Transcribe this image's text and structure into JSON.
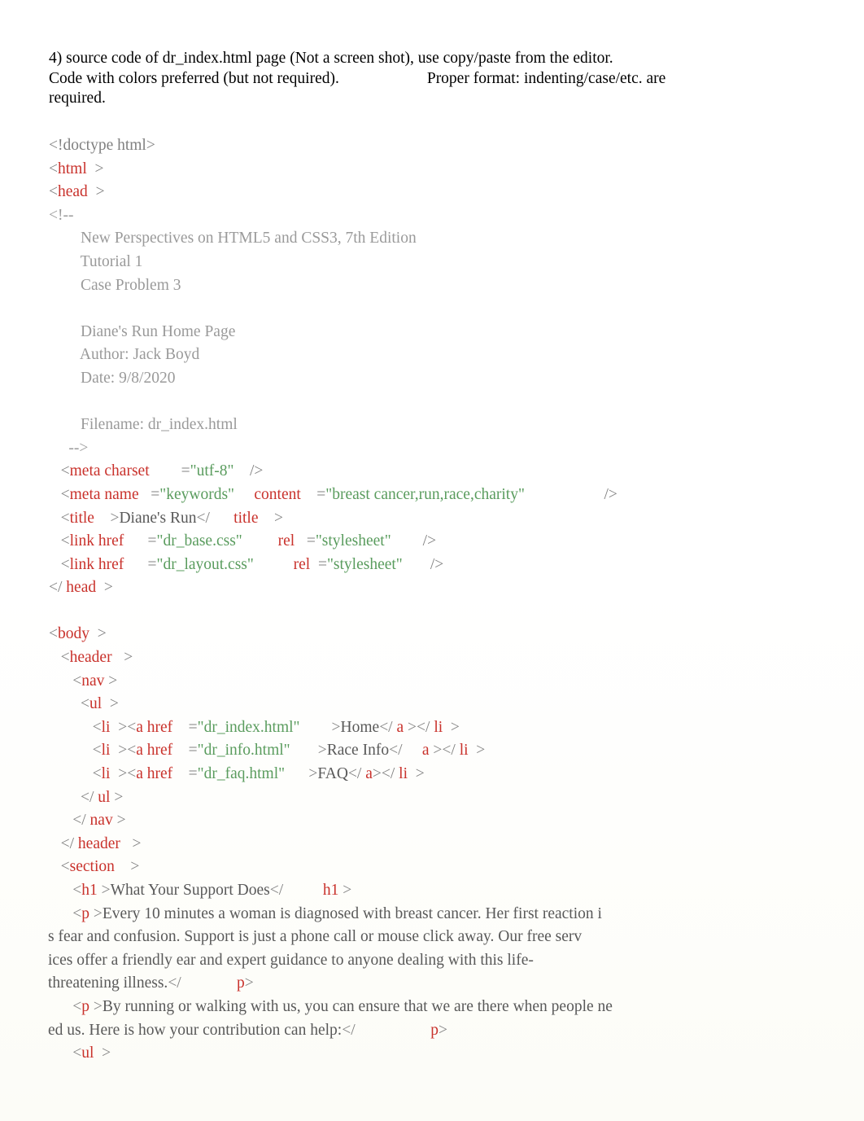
{
  "document": {
    "prompt": {
      "line1": "4) source code of dr_index.html page (Not a screen shot), use copy/paste from the editor.",
      "line2a": "Code with colors preferred (but not required).",
      "line2b": "Proper format: indenting/case/etc. are",
      "line3": "required."
    },
    "code_lines": [
      {
        "id": "l01",
        "text": "<!doctype html>"
      },
      {
        "id": "l02",
        "text": "<html  >"
      },
      {
        "id": "l03",
        "text": "<head  >"
      },
      {
        "id": "l04",
        "text": "<!--"
      },
      {
        "id": "l05",
        "text": "        New Perspectives on HTML5 and CSS3, 7th Edition"
      },
      {
        "id": "l06",
        "text": "        Tutorial 1"
      },
      {
        "id": "l07",
        "text": "        Case Problem 3"
      },
      {
        "id": "l08",
        "text": ""
      },
      {
        "id": "l09",
        "text": "        Diane's Run Home Page"
      },
      {
        "id": "l10",
        "text": "        Author: Jack Boyd"
      },
      {
        "id": "l11",
        "text": "        Date: 9/8/2020"
      },
      {
        "id": "l12",
        "text": ""
      },
      {
        "id": "l13",
        "text": "        Filename: dr_index.html"
      },
      {
        "id": "l14",
        "text": "     -->"
      },
      {
        "id": "l15",
        "text": "   <meta charset        =\"utf-8\"    />"
      },
      {
        "id": "l16",
        "text": "   <meta name   =\"keywords\"     content    =\"breast cancer,run,race,charity\"                    />"
      },
      {
        "id": "l17",
        "text": "   <title    >Diane's Run</      title    >"
      },
      {
        "id": "l18",
        "text": "   <link href      =\"dr_base.css\"         rel   =\"stylesheet\"        />"
      },
      {
        "id": "l19",
        "text": "   <link href      =\"dr_layout.css\"          rel  =\"stylesheet\"       />"
      },
      {
        "id": "l20",
        "text": "</ head  >"
      },
      {
        "id": "l21",
        "text": ""
      },
      {
        "id": "l22",
        "text": "<body  >"
      },
      {
        "id": "l23",
        "text": "   <header   >"
      },
      {
        "id": "l24",
        "text": "      <nav >"
      },
      {
        "id": "l25",
        "text": "        <ul  >"
      },
      {
        "id": "l26",
        "text": "           <li  ><a href    =\"dr_index.html\"        >Home</ a ></ li  >"
      },
      {
        "id": "l27",
        "text": "           <li  ><a href    =\"dr_info.html\"       >Race Info</     a ></ li  >"
      },
      {
        "id": "l28",
        "text": "           <li  ><a href    =\"dr_faq.html\"      >FAQ</ a ></ li  >"
      },
      {
        "id": "l29",
        "text": "        </ ul >"
      },
      {
        "id": "l30",
        "text": "      </ nav >"
      },
      {
        "id": "l31",
        "text": "   </ header   >"
      },
      {
        "id": "l32",
        "text": "   <section    >"
      },
      {
        "id": "l33",
        "text": "      <h1 >What Your Support Does</          h1 >"
      },
      {
        "id": "l34",
        "text": "      <p >Every 10 minutes a woman is diagnosed with breast cancer. Her first reaction i"
      },
      {
        "id": "l35",
        "text": "s fear and confusion. Support is just a phone call or mouse click away. Our free serv"
      },
      {
        "id": "l36",
        "text": "ices offer a friendly ear and expert guidance to anyone dealing with this life-"
      },
      {
        "id": "l37",
        "text": "threatening illness.</              p>"
      },
      {
        "id": "l38",
        "text": "      <p >By running or walking with us, you can ensure that we are there when people ne"
      },
      {
        "id": "l39",
        "text": "ed us. Here is how your contribution can help:</                   p>"
      },
      {
        "id": "l40",
        "text": "      <ul  >"
      }
    ],
    "colors": {
      "tag": "#c9322c",
      "attribute_value": "#5a9c5e",
      "comment": "#9a9a9a",
      "text": "#595959",
      "punctuation": "#808080",
      "background": "#ffffff"
    }
  }
}
